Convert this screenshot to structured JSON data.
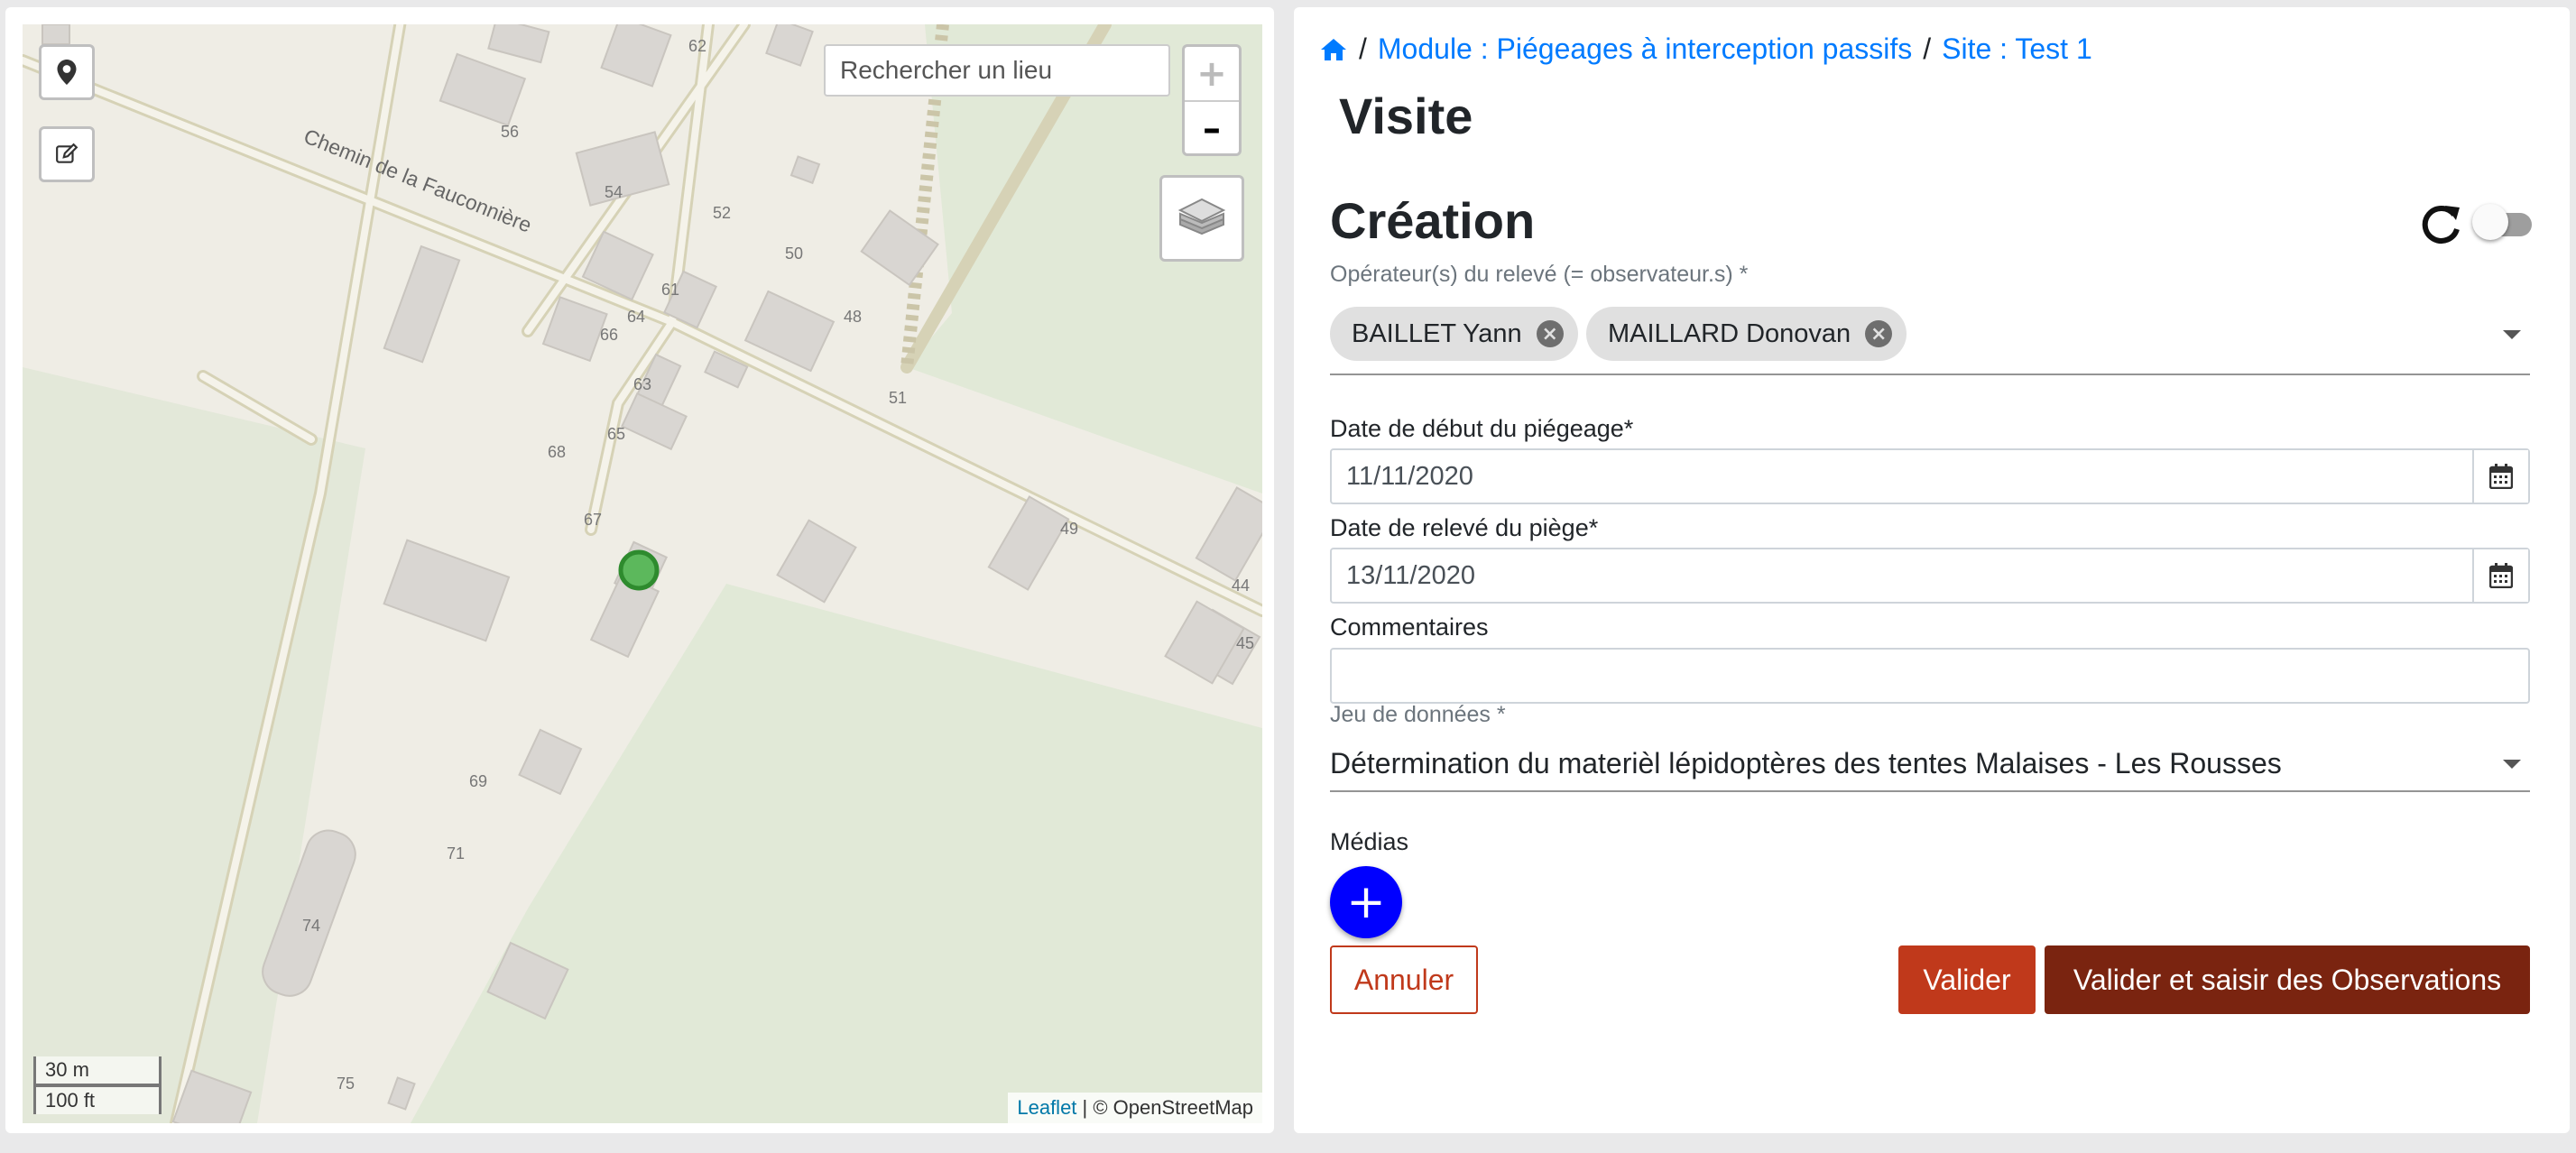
{
  "map": {
    "search_placeholder": "Rechercher un lieu",
    "zoom_in": "+",
    "zoom_out": "–",
    "scale_metric": "30 m",
    "scale_imperial": "100 ft",
    "attribution_link": "Leaflet",
    "attribution_rest": " | © OpenStreetMap",
    "street_name": "Chemin de la Fauconnière",
    "house_numbers": [
      "62",
      "56",
      "54",
      "52",
      "50",
      "48",
      "51",
      "61",
      "64",
      "66",
      "63",
      "65",
      "68",
      "67",
      "49",
      "44",
      "45",
      "69",
      "71",
      "74",
      "75"
    ],
    "marker_color": "#4caf50"
  },
  "breadcrumb": {
    "home_icon": "home-icon",
    "separator": "/",
    "module": "Module : Piégeages à interception passifs",
    "site": "Site : Test 1"
  },
  "page_title": "Visite",
  "form": {
    "title": "Création",
    "toggle_on": false,
    "operators_label": "Opérateur(s) du relevé (= observateur.s) *",
    "operators": [
      "BAILLET Yann",
      "MAILLARD Donovan"
    ],
    "start_date_label": "Date de début du piégeage*",
    "start_date_value": "11/11/2020",
    "trap_date_label": "Date de relevé du piège*",
    "trap_date_value": "13/11/2020",
    "comments_label": "Commentaires",
    "comments_value": "",
    "dataset_label": "Jeu de données *",
    "dataset_value": "Détermination du materièl lépidoptères des tentes Malaises - Les Rousses",
    "media_label": "Médias",
    "add_media": "+",
    "cancel_label": "Annuler",
    "validate_label": "Valider",
    "validate_obs_label": "Valider et saisir des Observations"
  },
  "colors": {
    "link": "#007bff",
    "accent_primary": "#c0391b",
    "accent_dark": "#7a2410",
    "fab": "#0000ff"
  }
}
